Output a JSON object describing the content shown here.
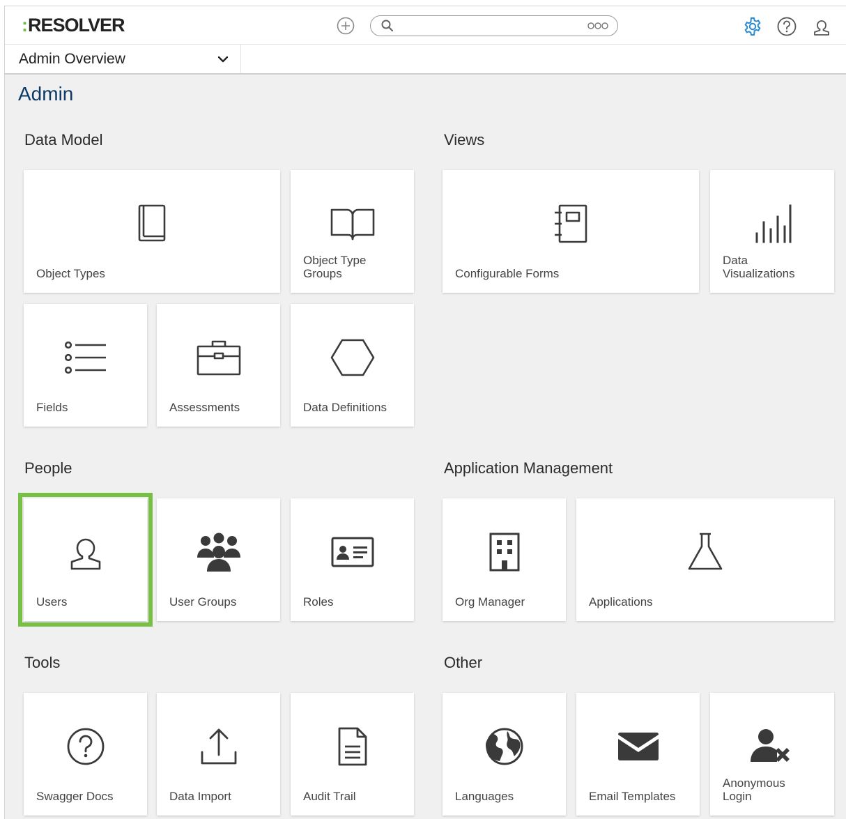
{
  "app": {
    "logo_text": "RESOLVER",
    "logo_colon": ":",
    "brand_accent": "#6cbe45",
    "title_color": "#0c3a66",
    "gear_color": "#2a8ad4"
  },
  "header": {
    "search_placeholder": "",
    "icons": [
      "plus-icon",
      "search-icon",
      "more-options-icon",
      "gear-icon",
      "help-icon",
      "user-icon"
    ]
  },
  "nav": {
    "dropdown_label": "Admin Overview"
  },
  "page": {
    "title": "Admin"
  },
  "sections": {
    "data_model": {
      "title": "Data Model",
      "tiles": {
        "object_types": "Object Types",
        "object_type_groups": "Object Type Groups",
        "fields": "Fields",
        "assessments": "Assessments",
        "data_definitions": "Data Definitions"
      }
    },
    "views": {
      "title": "Views",
      "tiles": {
        "configurable_forms": "Configurable Forms",
        "data_visualizations": "Data Visualizations"
      }
    },
    "people": {
      "title": "People",
      "tiles": {
        "users": "Users",
        "user_groups": "User Groups",
        "roles": "Roles"
      }
    },
    "app_management": {
      "title": "Application Management",
      "tiles": {
        "org_manager": "Org Manager",
        "applications": "Applications"
      }
    },
    "tools": {
      "title": "Tools",
      "tiles": {
        "swagger_docs": "Swagger Docs",
        "data_import": "Data Import",
        "audit_trail": "Audit Trail"
      }
    },
    "other": {
      "title": "Other",
      "tiles": {
        "languages": "Languages",
        "email_templates": "Email Templates",
        "anonymous_login": "Anonymous Login"
      }
    }
  },
  "highlight": {
    "selected_tile": "Users",
    "color": "#77c043"
  }
}
